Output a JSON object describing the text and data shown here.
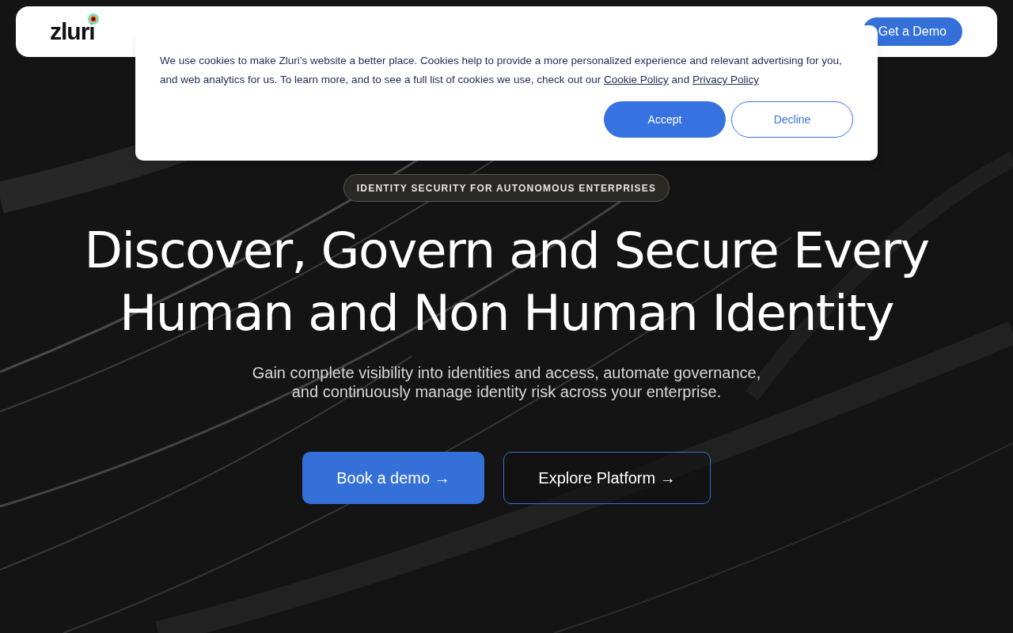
{
  "nav": {
    "logo": "zluri",
    "cta": "Get a Demo"
  },
  "cookie_banner": {
    "text": "We use cookies to make Zluri’s website a better place. Cookies help to provide a more personalized experience and relevant advertising for you, and web analytics for us. To learn more, and to see a full list of cookies we use, check out our",
    "links": [
      "Cookie Policy",
      "Privacy Policy"
    ],
    "joiner": "and",
    "buttons": [
      {
        "label": "Accept",
        "kind": "primary"
      },
      {
        "label": "Decline",
        "kind": "outline"
      }
    ]
  },
  "hero": {
    "badge": "IDENTITY SECURITY FOR AUTONOMOUS ENTERPRISES",
    "headline": [
      "Discover, Govern and Secure Every",
      "Human and Non Human Identity"
    ],
    "subtitle": [
      "Gain complete visibility into identities and access, automate governance,",
      "and continuously manage identity risk across your enterprise."
    ],
    "buttons": [
      {
        "label": "Book a demo →",
        "kind": "primary"
      },
      {
        "label": "Explore Platform →",
        "kind": "outline"
      }
    ]
  }
}
